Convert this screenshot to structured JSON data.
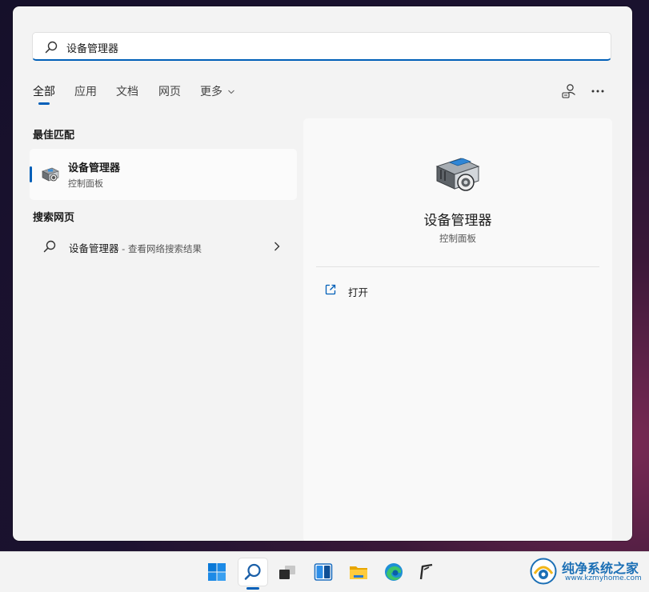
{
  "search": {
    "value": "设备管理器",
    "placeholder": ""
  },
  "tabs": [
    {
      "label": "全部",
      "active": true
    },
    {
      "label": "应用"
    },
    {
      "label": "文档"
    },
    {
      "label": "网页"
    },
    {
      "label": "更多"
    }
  ],
  "icons": {
    "search": "search-icon",
    "more_chevron": "chevron-down-icon",
    "account": "account-icon",
    "more_options": "more-options-icon"
  },
  "best_match": {
    "section_title": "最佳匹配",
    "name": "设备管理器",
    "subtitle": "控制面板"
  },
  "web_search": {
    "section_title": "搜索网页",
    "query": "设备管理器",
    "suffix": " - 查看网络搜索结果"
  },
  "detail": {
    "title": "设备管理器",
    "subtitle": "控制面板",
    "actions": [
      {
        "label": "打开",
        "icon": "open-external-icon"
      }
    ]
  },
  "taskbar": {
    "items": [
      "start-icon",
      "search-icon",
      "task-view-icon",
      "widgets-icon",
      "file-explorer-icon",
      "edge-icon",
      "app-icon"
    ]
  },
  "watermark": {
    "text": "纯净系统之家",
    "url": "www.kzmyhome.com"
  },
  "colors": {
    "accent": "#005fb8",
    "panel": "#f3f3f3",
    "watermark": "#1b6fb5"
  }
}
